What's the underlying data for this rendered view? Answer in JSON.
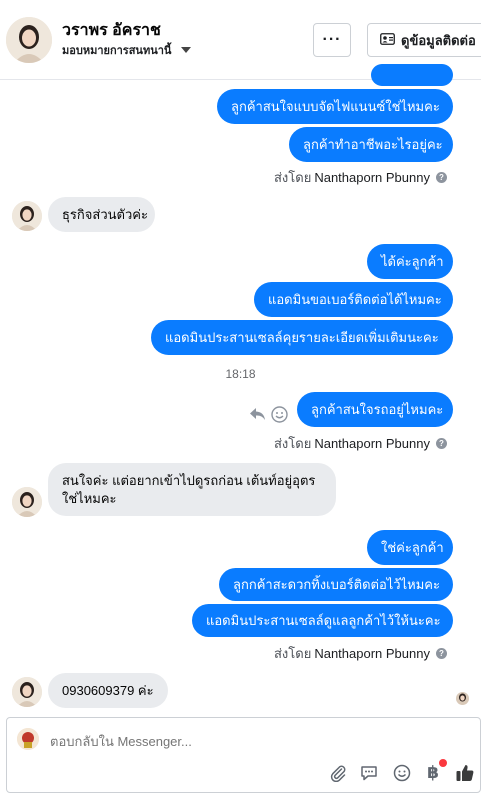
{
  "header": {
    "contact_name": "วราพร อัคราช",
    "assign_label": "มอบหมายการสนทนานี้",
    "more_label": "···",
    "contact_info_label": "ดูข้อมูลติดต่อ"
  },
  "messages": {
    "m1": "ลูกค้าสนใจแบบจัดไฟแนนซ์ใช่ไหมคะ",
    "m2": "ลูกค้าทำอาชีพอะไรอยู่คะ",
    "sent_by_1": "ส่งโดย",
    "sender_1": "Nanthaporn Pbunny",
    "m3": "ธุรกิจส่วนตัวค่ะ",
    "m4": "ได้ค่ะลูกค้า",
    "m5": "แอดมินขอเบอร์ติดต่อได้ไหมคะ",
    "m6": "แอดมินประสานเซลล์คุยรายละเอียดเพิ่มเติมนะคะ",
    "time": "18:18",
    "m7": "ลูกค้าสนใจรถอยู่ไหมคะ",
    "sent_by_2": "ส่งโดย",
    "sender_2": "Nanthaporn Pbunny",
    "m8_line1": "สนใจค่ะ แต่อยากเข้าไปดูรถก่อน เต้นท์อยู่อุตร",
    "m8_line2": "ใช่ไหมคะ",
    "m9": "ใช่ค่ะลูกค้า",
    "m10": "ลูกกค้าสะดวกทิ้งเบอร์ติดต่อไว้ไหมคะ",
    "m11": "แอดมินประสานเซลล์ดูแลลูกค้าไว้ให้นะคะ",
    "sent_by_3": "ส่งโดย",
    "sender_3": "Nanthaporn Pbunny",
    "m12": "0930609379 ค่ะ"
  },
  "composer": {
    "placeholder": "ตอบกลับใน Messenger..."
  },
  "icons": {
    "info": "info-icon",
    "reply": "reply-icon",
    "emoji": "emoji-icon",
    "attach": "paperclip-icon",
    "saved_replies": "saved-replies-icon",
    "baht": "baht-icon",
    "like": "thumbs-up-icon"
  },
  "colors": {
    "outgoing": "#0a7cff",
    "incoming": "#e9ebee",
    "notification": "#fa383e"
  }
}
